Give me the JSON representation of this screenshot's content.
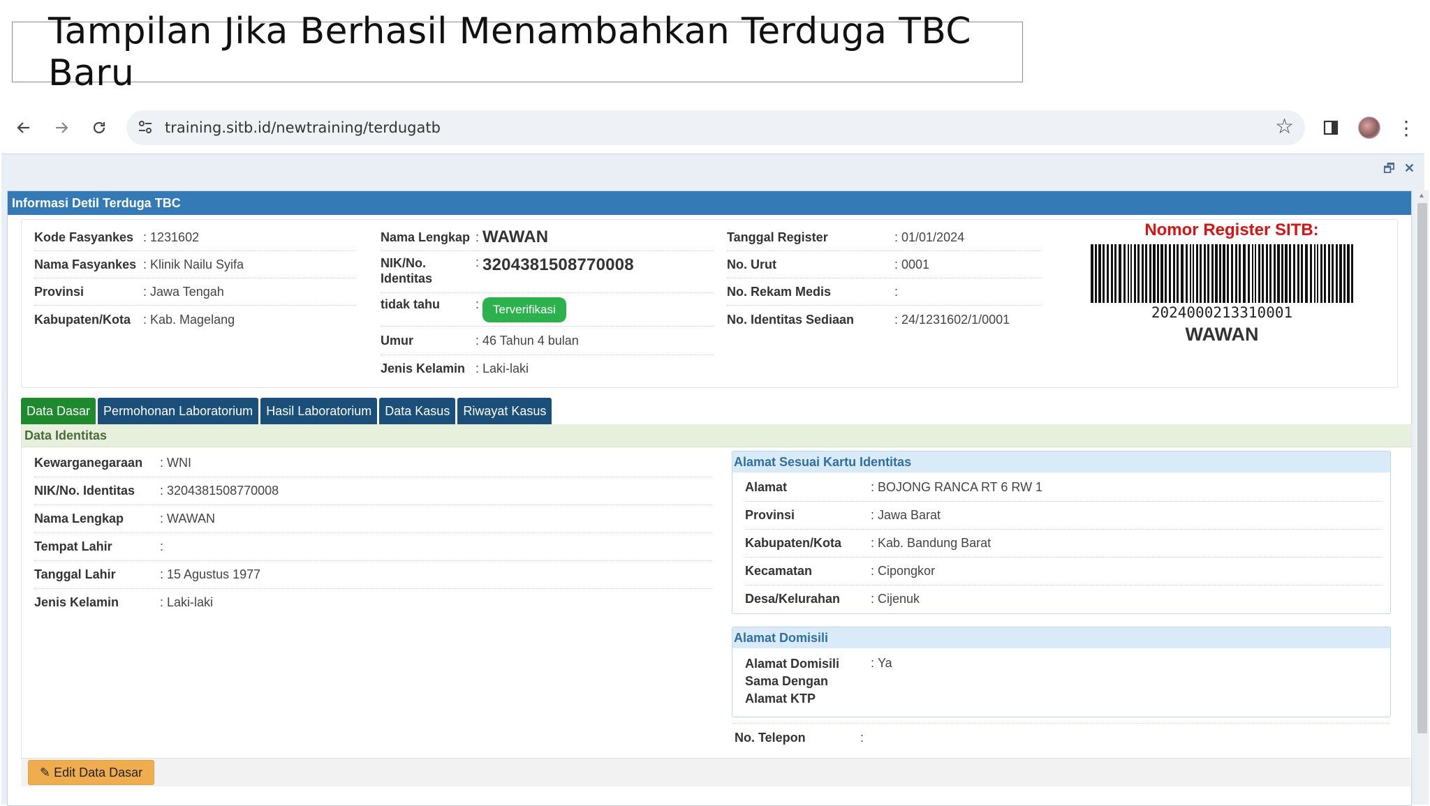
{
  "slide": {
    "title": "Tampilan Jika Berhasil Menambahkan Terduga TBC Baru"
  },
  "browser": {
    "url": "training.sitb.id/newtraining/terdugatb",
    "icons": [
      "back-arrow-icon",
      "forward-arrow-icon",
      "reload-icon",
      "site-settings-icon",
      "star-icon",
      "side-panel-icon",
      "profile-avatar",
      "menu-dots-icon"
    ]
  },
  "panel": {
    "title": "Informasi Detil Terduga TBC"
  },
  "info": {
    "col1": [
      {
        "label": "Kode Fasyankes",
        "value": "1231602"
      },
      {
        "label": "Nama Fasyankes",
        "value": "Klinik Nailu Syifa"
      },
      {
        "label": "Provinsi",
        "value": "Jawa Tengah"
      },
      {
        "label": "Kabupaten/Kota",
        "value": "Kab. Magelang"
      }
    ],
    "col2": {
      "nama_label": "Nama Lengkap",
      "nama_value": "WAWAN",
      "nik_label": "NIK/No. Identitas",
      "nik_value": "3204381508770008",
      "status_label": "tidak tahu",
      "status_badge": "Terverifikasi",
      "umur_label": "Umur",
      "umur_value": "46 Tahun 4 bulan",
      "jk_label": "Jenis Kelamin",
      "jk_value": "Laki-laki"
    },
    "col3": [
      {
        "label": "Tanggal Register",
        "value": "01/01/2024"
      },
      {
        "label": "No. Urut",
        "value": "0001"
      },
      {
        "label": "No. Rekam Medis",
        "value": ""
      },
      {
        "label": "No. Identitas Sediaan",
        "value": "24/1231602/1/0001"
      }
    ],
    "register": {
      "title": "Nomor Register SITB:",
      "number": "2024000213310001",
      "name": "WAWAN"
    }
  },
  "tabs": [
    "Data Dasar",
    "Permohonan Laboratorium",
    "Hasil Laboratorium",
    "Data Kasus",
    "Riwayat Kasus"
  ],
  "data_identitas": {
    "title": "Data Identitas",
    "rows": [
      {
        "label": "Kewarganegaraan",
        "value": "WNI"
      },
      {
        "label": "NIK/No. Identitas",
        "value": "3204381508770008"
      },
      {
        "label": "Nama Lengkap",
        "value": "WAWAN"
      },
      {
        "label": "Tempat Lahir",
        "value": ""
      },
      {
        "label": "Tanggal Lahir",
        "value": "15 Agustus 1977"
      },
      {
        "label": "Jenis Kelamin",
        "value": "Laki-laki"
      }
    ]
  },
  "alamat_ktp": {
    "title": "Alamat Sesuai Kartu Identitas",
    "rows": [
      {
        "label": "Alamat",
        "value": "BOJONG RANCA RT 6 RW 1"
      },
      {
        "label": "Provinsi",
        "value": "Jawa Barat"
      },
      {
        "label": "Kabupaten/Kota",
        "value": "Kab. Bandung Barat"
      },
      {
        "label": "Kecamatan",
        "value": "Cipongkor"
      },
      {
        "label": "Desa/Kelurahan",
        "value": "Cijenuk"
      }
    ]
  },
  "alamat_domisili": {
    "title": "Alamat Domisili",
    "label": "Alamat Domisili Sama Dengan Alamat KTP",
    "value": "Ya"
  },
  "telepon": {
    "label": "No. Telepon",
    "value": ""
  },
  "footer": {
    "edit_button": "Edit Data Dasar"
  },
  "colors": {
    "header_blue": "#337ab7",
    "tab_active": "#1e8a2e",
    "tab_dark": "#1a4f7a",
    "register_red": "#e01010",
    "badge_green": "#2bb24c",
    "edit_orange": "#f0ad4e"
  }
}
